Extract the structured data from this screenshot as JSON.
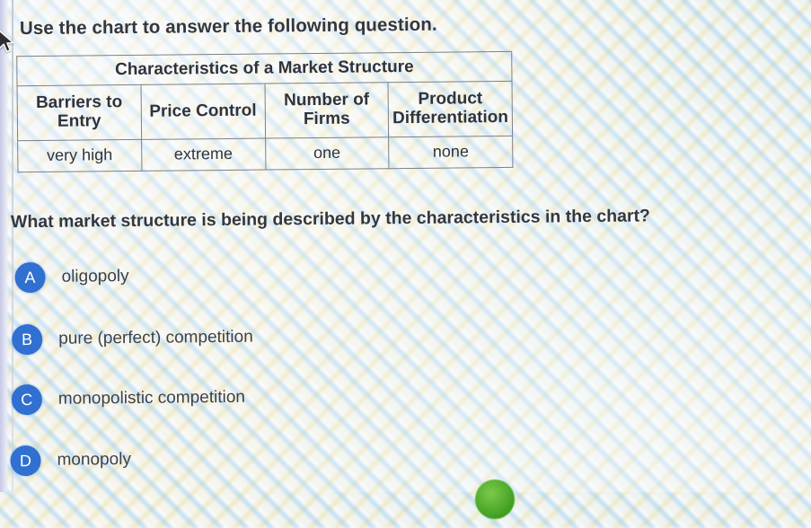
{
  "prompt": "Use the chart to answer the following question.",
  "table": {
    "title": "Characteristics of a Market Structure",
    "headers": [
      "Barriers to Entry",
      "Price Control",
      "Number of Firms",
      "Product Differentiation"
    ],
    "rows": [
      [
        "very high",
        "extreme",
        "one",
        "none"
      ]
    ]
  },
  "question": "What market structure is being described by the characteristics in the chart?",
  "options": [
    {
      "letter": "A",
      "label": "oligopoly"
    },
    {
      "letter": "B",
      "label": "pure (perfect) competition"
    },
    {
      "letter": "C",
      "label": "monopolistic competition"
    },
    {
      "letter": "D",
      "label": "monopoly"
    }
  ],
  "icons": {
    "cursor": "arrow-pointer-icon",
    "green_bubble": "green-circle-icon"
  },
  "colors": {
    "badge_blue": "#2f6fd0",
    "text_dark": "#33353d",
    "table_border": "#7b8089",
    "green_bubble": "#3f9e1e",
    "left_strip": "#c7c9e4"
  }
}
